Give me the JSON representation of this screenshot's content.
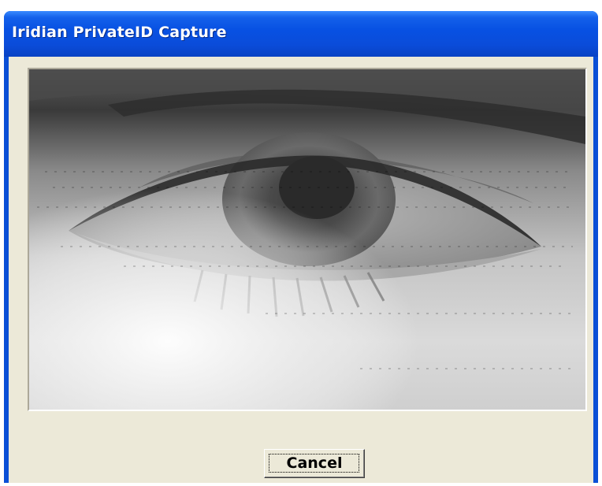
{
  "window": {
    "title": "Iridian PrivateID Capture"
  },
  "capture": {
    "image_description_icon": "eye-camera-preview"
  },
  "buttons": {
    "cancel_label": "Cancel"
  },
  "colors": {
    "titlebar": "#0a4cd9",
    "client_background": "#ece9d8",
    "title_text": "#ffffff"
  }
}
